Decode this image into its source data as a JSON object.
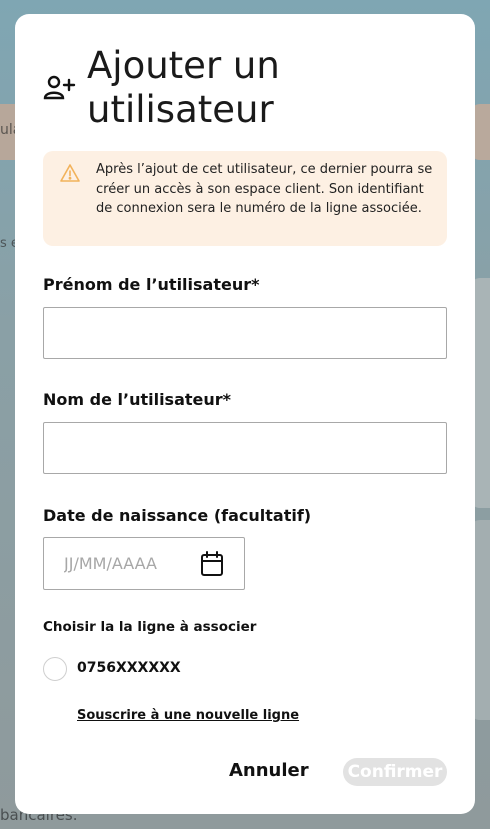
{
  "background": {
    "fragment_left": "ula",
    "fragment_mid": "s e",
    "fragment_bottom": "bancaires."
  },
  "modal": {
    "title": "Ajouter un utilisateur",
    "title_icon": "add-user-icon",
    "alert": {
      "icon": "warning-icon",
      "text": "Après l’ajout de cet utilisateur, ce dernier pourra se créer un accès à son espace client. Son identifiant de connexion sera le numéro de la ligne associée."
    },
    "first_name": {
      "label": "Prénom de l’utilisateur*",
      "value": ""
    },
    "last_name": {
      "label": "Nom de l’utilisateur*",
      "value": ""
    },
    "birth_date": {
      "label": "Date de naissance (facultatif)",
      "placeholder": "JJ/MM/AAAA",
      "value": "",
      "icon": "calendar-icon"
    },
    "line_section": {
      "label": "Choisir la la ligne à associer",
      "options": [
        {
          "label": "0756XXXXXX",
          "selected": false
        }
      ],
      "subscribe_link": "Souscrire à une nouvelle ligne"
    },
    "actions": {
      "cancel": "Annuler",
      "confirm": "Confirmer"
    },
    "colors": {
      "alert_bg": "#fdf0e3",
      "alert_icon": "#f2b25a",
      "confirm_disabled": "#e2e2e2"
    }
  }
}
